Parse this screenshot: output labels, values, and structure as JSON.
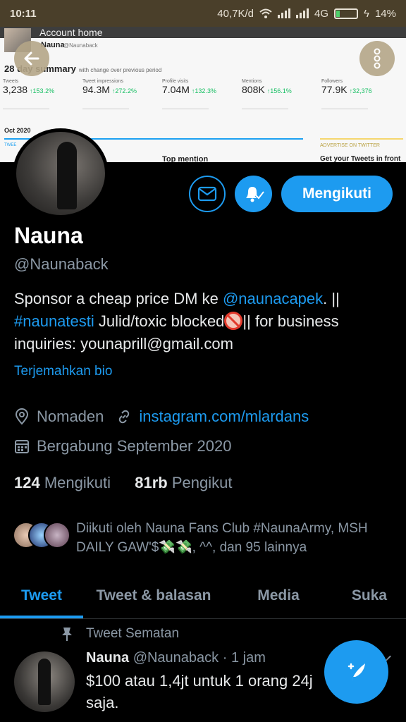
{
  "status_bar": {
    "time": "10:11",
    "network_speed": "40,7K/d",
    "network_type": "4G",
    "battery": "14%"
  },
  "banner": {
    "title": "Account home",
    "name": "Nauna",
    "handle": "@Naunaback",
    "summary": "28 day summary",
    "summary_note": "with change over previous period",
    "stats": [
      {
        "label": "Tweets",
        "value": "3,238",
        "change": "↑153.2%"
      },
      {
        "label": "Tweet impressions",
        "value": "94.3M",
        "change": "↑272.2%"
      },
      {
        "label": "Profile visits",
        "value": "7.04M",
        "change": "↑132.3%"
      },
      {
        "label": "Mentions",
        "value": "808K",
        "change": "↑156.1%"
      },
      {
        "label": "Followers",
        "value": "77.9K",
        "change": "↑32,376"
      }
    ],
    "month": "Oct 2020",
    "tweets_label": "TWEE",
    "top_mention": "Top mention",
    "advertise": "ADVERTISE ON TWITTER",
    "get_tweets": "Get your Tweets in front o"
  },
  "profile": {
    "follow_label": "Mengikuti",
    "name": "Nauna",
    "handle": "@Naunaback",
    "bio": {
      "part1": "Sponsor a cheap price DM ke ",
      "mention": "@naunacapek",
      "part2": ". || ",
      "hashtag": "#naunatesti",
      "part3": " Julid/toxic blocked",
      "part4": "|| for business inquiries: younaprill@gmail.com"
    },
    "translate": "Terjemahkan bio",
    "location": "Nomaden",
    "website": "instagram.com/mlardans",
    "joined": "Bergabung September 2020",
    "following_count": "124",
    "following_label": "Mengikuti",
    "followers_count": "81rb",
    "followers_label": "Pengikut",
    "followed_by": "Diikuti oleh Nauna Fans Club #NaunaArmy, MSH DAILY GAW'$💸💸, ^^, dan 95 lainnya"
  },
  "tabs": [
    "Tweet",
    "Tweet & balasan",
    "Media",
    "Suka"
  ],
  "pinned_tweet": {
    "pinned_label": "Tweet Sematan",
    "name": "Nauna",
    "handle_time": "@Naunaback · 1 jam",
    "text": "$100 atau 1,4jt untuk 1 orang 24j saja."
  },
  "colors": {
    "accent": "#1d9bf0",
    "background": "#000000",
    "secondary_text": "#8b98a5"
  },
  "icons": [
    "back-arrow-icon",
    "more-vertical-icon",
    "mail-icon",
    "bell-icon",
    "location-icon",
    "link-icon",
    "calendar-icon",
    "pin-icon",
    "compose-icon"
  ]
}
